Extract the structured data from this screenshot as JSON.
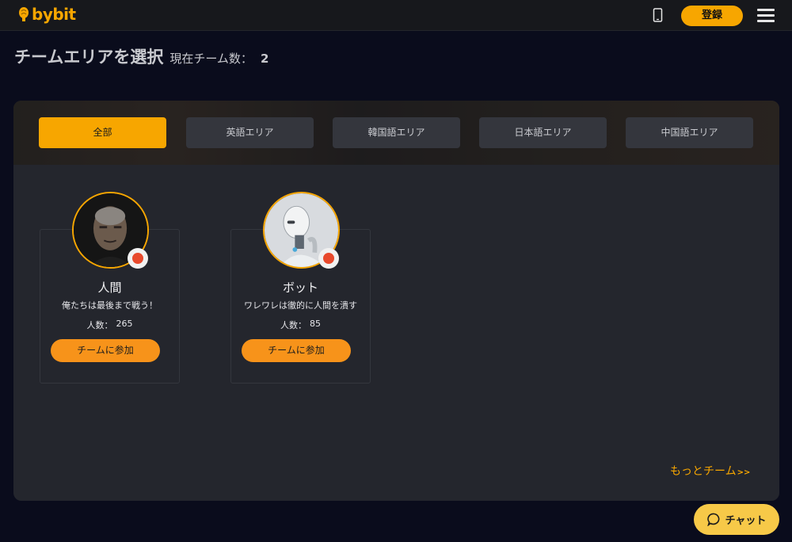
{
  "header": {
    "logo_text": "bybit",
    "register_label": "登録",
    "accent": "#f7a600"
  },
  "page": {
    "title": "チームエリアを選択",
    "team_count_label": "現在チーム数：",
    "team_count": "2"
  },
  "tabs": [
    {
      "label": "全部",
      "active": true
    },
    {
      "label": "英語エリア",
      "active": false
    },
    {
      "label": "韓国語エリア",
      "active": false
    },
    {
      "label": "日本語エリア",
      "active": false
    },
    {
      "label": "中国語エリア",
      "active": false
    }
  ],
  "teams": [
    {
      "name": "人間",
      "slogan": "俺たちは最後まで戦う！",
      "members_label": "人数：",
      "members": "265",
      "join_label": "チームに参加",
      "avatar": "human-portrait",
      "status_color": "#e8492c"
    },
    {
      "name": "ボット",
      "slogan": "ワレワレは徹的に人間を潰す",
      "members_label": "人数：",
      "members": "85",
      "join_label": "チームに参加",
      "avatar": "robot-portrait",
      "status_color": "#e8492c"
    }
  ],
  "more_teams": {
    "label": "もっとチーム",
    "arrows": ">>"
  },
  "chat": {
    "label": "チャット",
    "icon": "chat-bubble-icon"
  }
}
